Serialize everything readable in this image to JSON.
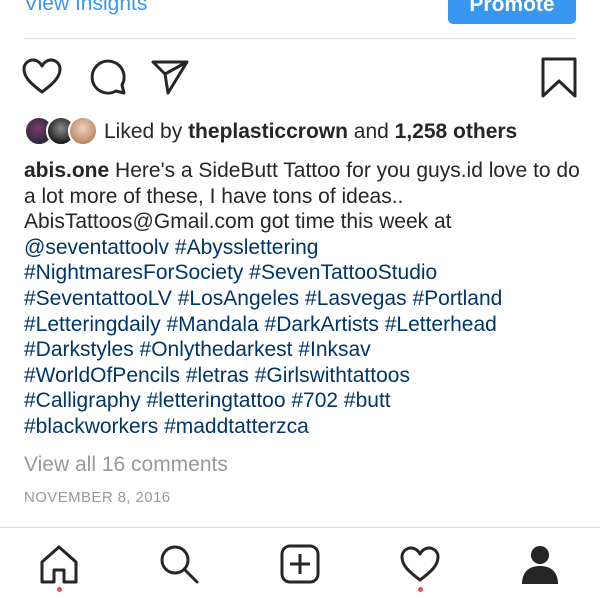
{
  "header": {
    "insights_label": "View Insights",
    "promote_label": "Promote"
  },
  "actions": {
    "like_icon": "heart-icon",
    "comment_icon": "comment-icon",
    "share_icon": "share-icon",
    "save_icon": "bookmark-icon"
  },
  "likes": {
    "prefix": "Liked by",
    "user": "theplasticcrown",
    "conjunction": "and",
    "others": "1,258 others"
  },
  "caption": {
    "username": "abis.one",
    "text": "Here's a SideButt Tattoo for you guys.id love to do a lot more of these, I have tons of ideas.. AbisTattoos@Gmail.com got time this week at",
    "mention": "@seventattoolv",
    "hashtags": [
      "#Abysslettering",
      "#NightmaresForSociety",
      "#SevenTattooStudio",
      "#SeventattooLV",
      "#LosAngeles",
      "#Lasvegas",
      "#Portland",
      "#Letteringdaily",
      "#Mandala",
      "#DarkArtists",
      "#Letterhead",
      "#Darkstyles",
      "#Onlythedarkest",
      "#Inksav",
      "#WorldOfPencils",
      "#letras",
      "#Girlswithtattoos",
      "#Calligraphy",
      "#letteringtattoo",
      "#702",
      "#butt",
      "#blackworkers",
      "#maddtatterzca"
    ]
  },
  "comments": {
    "view_all_label": "View all 16 comments"
  },
  "post": {
    "date": "NOVEMBER 8, 2016"
  },
  "nav": {
    "items": [
      "home-icon",
      "search-icon",
      "new-post-icon",
      "activity-icon",
      "profile-icon"
    ],
    "notification_color": "#ed4956"
  },
  "colors": {
    "accent": "#3897f0",
    "hashtag": "#003569",
    "muted": "#999999",
    "text": "#262626"
  }
}
